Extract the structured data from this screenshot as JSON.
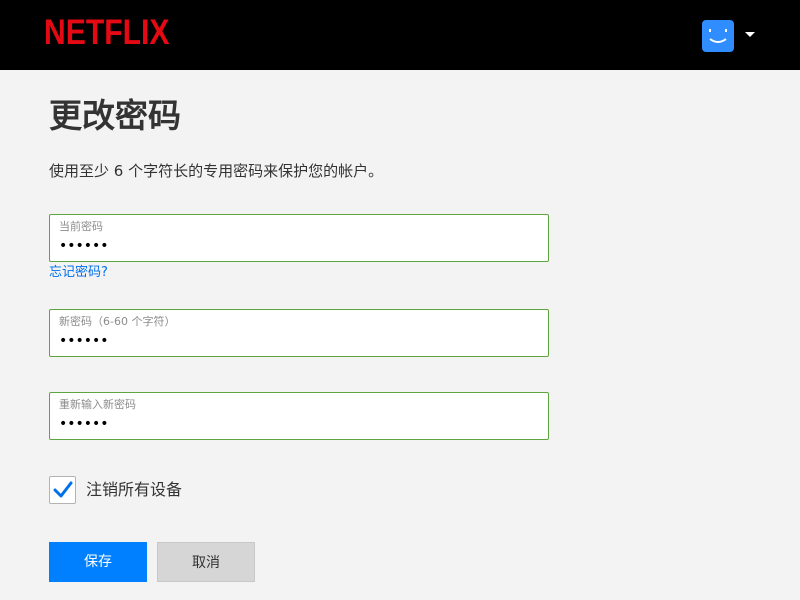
{
  "header": {
    "logo_text": "NETFLIX",
    "logo_color": "#e50914",
    "profile_icon": "smiley-profile-icon",
    "profile_color": "#2f8dff"
  },
  "page": {
    "title": "更改密码",
    "subtitle": "使用至少 6 个字符长的专用密码来保护您的帐户。"
  },
  "fields": {
    "current": {
      "label": "当前密码",
      "value": "••••••"
    },
    "forgot_link": "忘记密码?",
    "new": {
      "label": "新密码（6-60 个字符）",
      "value": "••••••"
    },
    "confirm": {
      "label": "重新输入新密码",
      "value": "••••••"
    }
  },
  "signout": {
    "label": "注销所有设备",
    "checked": true,
    "check_color": "#0071eb"
  },
  "buttons": {
    "save": "保存",
    "cancel": "取消"
  },
  "colors": {
    "field_border": "#5fa53f",
    "save_bg": "#0080ff",
    "cancel_bg": "#d6d6d6"
  }
}
